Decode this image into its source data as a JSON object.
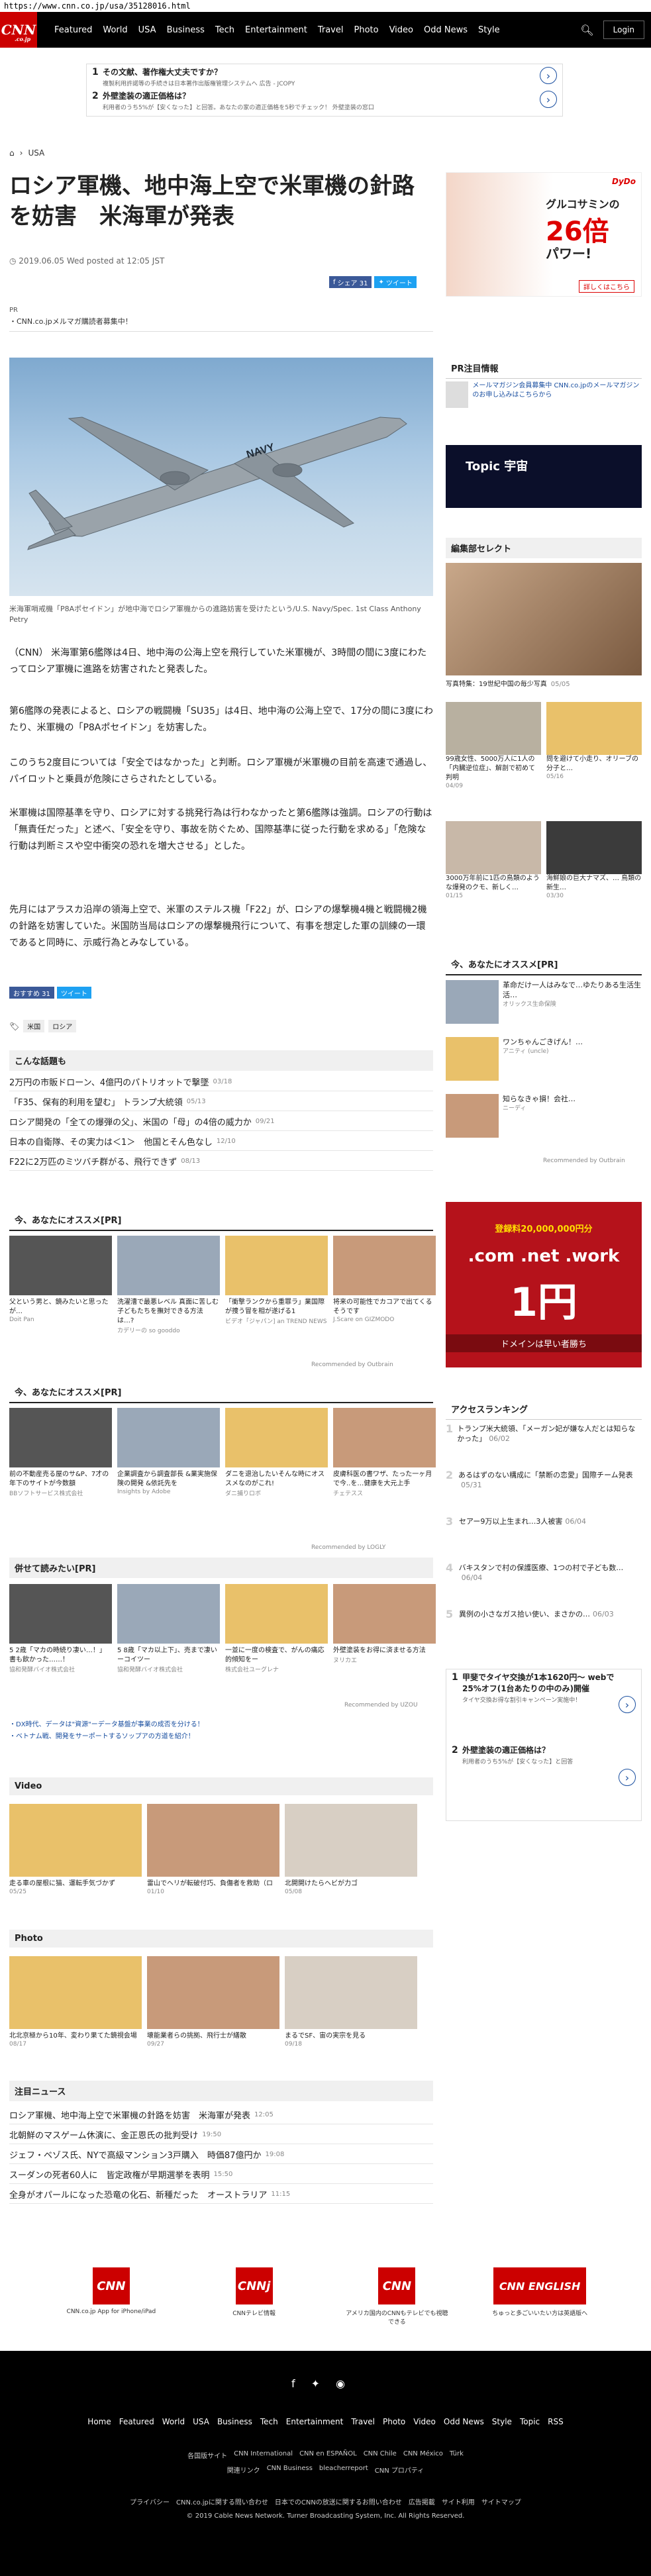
{
  "url": "https://www.cnn.co.jp/usa/35128016.html",
  "nav": {
    "logo": "CNN",
    "logo_sub": ".co.jp",
    "items": [
      "Featured",
      "World",
      "USA",
      "Business",
      "Tech",
      "Entertainment",
      "Travel",
      "Photo",
      "Video",
      "Odd News",
      "Style"
    ],
    "login": "Login"
  },
  "top_ads": [
    {
      "num": "1",
      "title": "その文献、著作権大丈夫ですか？",
      "sub": "複製利用許諾等の手続きは日本著作出版権管理システムへ  広告 ‐ JCOPY"
    },
    {
      "num": "2",
      "title": "外壁塗装の適正価格は？",
      "sub": "利用者のうち5%が【安くなった】と回答。あなたの家の適正価格を5秒でチェック！ 外壁塗装の窓口"
    }
  ],
  "breadcrumb": "USA",
  "headline": "ロシア軍機、地中海上空で米軍機の針路を妨害　米海軍が発表",
  "date": "2019.06.05 Wed posted at 12:05 JST",
  "share": {
    "fb": "シェア 31",
    "tw": "ツイート"
  },
  "pr_label": "PR",
  "pr_text": "・CNN.co.jpメルマガ購読者募集中！",
  "hero_caption": "米海軍哨戒機「P8Aポセイドン」が地中海でロシア軍機からの進路妨害を受けたという/U.S. Navy/Spec. 1st Class Anthony Petry",
  "body": [
    "（CNN） 米海軍第6艦隊は4日、地中海の公海上空を飛行していた米軍機が、3時間の間に3度にわたってロシア軍機に進路を妨害されたと発表した。",
    "第6艦隊の発表によると、ロシアの戦闘機「SU35」は4日、地中海の公海上空で、17分の間に3度にわたり、米軍機の「P8Aポセイドン」を妨害した。",
    "このうち2度目については「安全ではなかった」と判断。ロシア軍機が米軍機の目前を高速で通過し、パイロットと乗員が危険にさらされたとしている。",
    "米軍機は国際基準を守り、ロシアに対する挑発行為は行わなかったと第6艦隊は強調。ロシアの行動は「無責任だった」と述べ、「安全を守り、事故を防ぐため、国際基準に従った行動を求める」「危険な行動は判断ミスや空中衝突の恐れを増大させる」とした。",
    "先月にはアラスカ沿岸の領海上空で、米軍のステルス機「F22」が、ロシアの爆撃機4機と戦闘機2機の針路を妨害していた。米国防当局はロシアの爆撃機飛行について、有事を想定した軍の訓練の一環であると同時に、示威行為とみなしている。"
  ],
  "share2": {
    "fb": "おすすめ 31",
    "tw": "ツイート"
  },
  "tags": [
    "米国",
    "ロシア"
  ],
  "topics_title": "こんな話題も",
  "topics": [
    {
      "t": "2万円の市販ドローン、4億円のパトリオットで撃墜",
      "d": "03/18"
    },
    {
      "t": "「F35、保有的利用を望む」 トランプ大統領",
      "d": "05/13"
    },
    {
      "t": "ロシア開発の「全ての爆弾の父」、米国の「母」の4倍の威力か",
      "d": "09/21"
    },
    {
      "t": "日本の自衛隊、その実力は＜1＞　他国とそん色なし",
      "d": "12/10"
    },
    {
      "t": "F22に2万匹のミツバチ群がる、飛行できず",
      "d": "08/13"
    }
  ],
  "rec1_title": "今、あなたにオススメ[PR]",
  "rec1": [
    {
      "cap": "父という男と、鏡みたいと思ったが…",
      "src": "Doit Pan"
    },
    {
      "cap": "洗濯漕で最悪レベル 真面に苦しむ子どもたちを撫対できる方法は…?",
      "src": "カデリーの so gooddo"
    },
    {
      "cap": "「衝撃ランクから重罪ラ」業国際が捜う冒を相が遂げる1",
      "src": "ビデオ「ジャパン] an TREND NEWS"
    },
    {
      "cap": "将来の可能性でカコアで出てくるそうです",
      "src": "J.Scare on GIZMODO"
    }
  ],
  "rec_by1": "Recommended by Outbrain",
  "rec2_title": "今、あなたにオススメ[PR]",
  "rec2": [
    {
      "cap": "前の不動産売る屋のサ&P、7才の年下のサイトが今数額",
      "src": "BBソフトサービス株式会社"
    },
    {
      "cap": "企業調査から調査部長 &業実施保険の開発 &依託先を",
      "src": "Insights by Adobe"
    },
    {
      "cap": "ダニを退治したいそんな時にオススメなのがこれ!",
      "src": "ダニ捕りロボ"
    },
    {
      "cap": "皮膚科医の書ワザ、たった一ヶ月で今..を…健康を大元上手",
      "src": "チェテスス"
    }
  ],
  "rec_by2": "Recommended by LOGLY",
  "rec3_title": "併せて読みたい[PR]",
  "rec3": [
    {
      "cap": "5 2歳「マカの時続り凄い…！」書も飲かった……！",
      "src": "協和発酵バイオ株式会社"
    },
    {
      "cap": "5 8歳「マカ以上下」、売まで凄いーコイツー",
      "src": "協和発酵バイオ株式会社"
    },
    {
      "cap": "一並に一度の検査で、がんの痛応的傾知をー",
      "src": "株式会社ユーグレナ"
    },
    {
      "cap": "外壁塗装をお得に済ませる方法",
      "src": "ヌリカエ"
    }
  ],
  "rec_by3": "Recommended by UZOU",
  "pr2": [
    "・DX時代、データは\"資源\"ーデータ基盤が事業の成否を分ける！",
    "・ベトナム戦、開発をサーポートするソップアの方道を紹介！"
  ],
  "video_title": "Video",
  "videos": [
    {
      "cap": "走る車の屋根に猫、運転手気づかず",
      "d": "05/25"
    },
    {
      "cap": "雷山でヘリが転破付巧、負傷者を救助（ロ",
      "d": "01/10"
    },
    {
      "cap": "北開開けたらヘビが力ゴ",
      "d": "05/08"
    }
  ],
  "photo_title": "Photo",
  "photos": [
    {
      "cap": "北北京極から10年、変わり果てた鏡視会場",
      "d": "08/17"
    },
    {
      "cap": "壊能業者らの挑拠、飛行士が繕散",
      "d": "09/27"
    },
    {
      "cap": "まるでSF、宙の実宗を見る",
      "d": "09/18"
    }
  ],
  "news_title": "注目ニュース",
  "news": [
    {
      "t": "ロシア軍機、地中海上空で米軍機の針路を妨害　米海軍が発表",
      "d": "12:05"
    },
    {
      "t": "北朝鮮のマスゲーム休演に、金正恩氏の批判受け",
      "d": "19:50"
    },
    {
      "t": "ジェフ・ベゾス氏、NYで高級マンション3戸購入　時価87億円か",
      "d": "19:08"
    },
    {
      "t": "スーダンの死者60人に　皆定政権が早期選挙を表明",
      "d": "15:50"
    },
    {
      "t": "全身がオパールになった恐竜の化石、新種だった　オーストラリア",
      "d": "11:15"
    }
  ],
  "side": {
    "ad_brand": "DyDo",
    "ad_title": "グルコサミンの",
    "ad_big": "26倍",
    "ad_power": "パワー!",
    "ad_link": "詳しくはこちら",
    "pr_title": "PR注目情報",
    "pr_item": "メールマガジン会員募集中 CNN.co.jpのメールマガジンのお申し込みはこちらから",
    "topic": "Topic 宇宙",
    "editor_title": "編集部セレクト",
    "editor": [
      {
        "cap": "写真特集：19世紀中国の毎少写真",
        "d": "05/05"
      },
      {
        "cap": "99歳女性、5000万人に1人の「内臓逆位症」、解剖で初めて判明",
        "d": "04/09"
      },
      {
        "cap": "問を避けて小走り、オリーブの分子と…",
        "d": "05/16"
      },
      {
        "cap": "3000万年前に1匹の鳥類のような爆発のクモ、新しく…",
        "d": "01/15"
      },
      {
        "cap": "海鮮娘の巨大ナマズ、… 鳥類の新生…",
        "d": "03/30"
      }
    ],
    "rec_title": "今、あなたにオススメ[PR]",
    "rec": [
      {
        "cap": "革命だけ一人はみなで…ゆたりある生活生活…",
        "src": "オリックス生命保険"
      },
      {
        "cap": "ワンちゃんごきげん！…",
        "src": "アニティ (uncle)"
      },
      {
        "cap": "知らなきゃ損！会社…",
        "src": "ニーディ"
      }
    ],
    "rec_by": "Recommended by Outbrain",
    "domain_ad": {
      "top": "登録料20,000,000円分",
      "mid": ".com .net .work",
      "price": "1円",
      "sub": "ドメインは早い者勝ち"
    },
    "rank_title": "アクセスランキング",
    "ranking": [
      "トランプ米大統領、「メーガン妃が嫌な人だとは知らなかった」",
      "あるはずのない構成に「禁断の恋愛」国際チーム発表",
      "セアー9万以上生まれ…3人被害",
      "バキスタンで村の保護医療、1つの村で子ども数…",
      "異例の小さなガス拾い使い、まさかの…"
    ],
    "rank_dates": [
      "06/02",
      "05/31",
      "06/04",
      "06/04",
      "06/03"
    ],
    "ad2": [
      {
        "num": "1",
        "title": "甲斐でタイヤ交換が1本1620円～ webで25%オフ(1台あたりの中のみ)開催",
        "sub": "タイヤ交換お得な割引キャンペーン実施中！"
      },
      {
        "num": "2",
        "title": "外壁塗装の適正価格は？",
        "sub": "利用者のうち5%が【安くなった】と回答"
      }
    ]
  },
  "footer": {
    "logos": [
      {
        "mk": "CNN",
        "t": "CNN.co.jp App for iPhone/iPad"
      },
      {
        "mk": "CNNj",
        "t": "CNNテレビ情報"
      },
      {
        "mk": "CNN",
        "t": "アメリカ国内のCNNもテレビでも視聴できる"
      },
      {
        "mk": "CNN ENGLISH",
        "t": "ちゅっと多ごいいたい方は英語版へ"
      }
    ],
    "nav": [
      "Home",
      "Featured",
      "World",
      "USA",
      "Business",
      "Tech",
      "Entertainment",
      "Travel",
      "Photo",
      "Video",
      "Odd News",
      "Style",
      "Topic",
      "RSS"
    ],
    "sub1": [
      "各国版サイト",
      "CNN International",
      "CNN en ESPAÑOL",
      "CNN Chile",
      "CNN México",
      "Türk"
    ],
    "sub2": [
      "関連リンク",
      "CNN Business",
      "bleacherreport",
      "CNN プロパティ"
    ],
    "sub3": [
      "プライバシー",
      "CNN.co.jpに関する問い合わせ",
      "日本でのCNNの放送に関するお問い合わせ",
      "広告掲載",
      "サイト利用",
      "サイトマップ"
    ],
    "copyright": "© 2019 Cable News Network.  Turner Broadcasting System, Inc.  All Rights Reserved."
  },
  "colors": {
    "brand": "#cc0000",
    "fb": "#3b5998",
    "tw": "#1da1f2",
    "link_blue": "#1a4fa0"
  }
}
